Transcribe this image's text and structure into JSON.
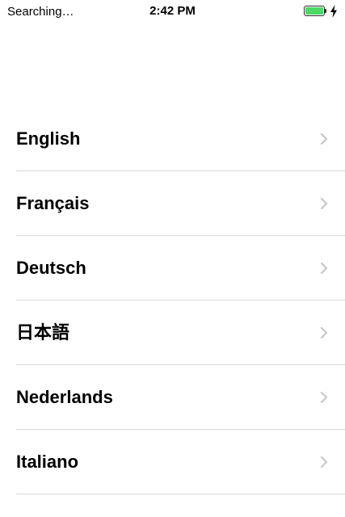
{
  "status_bar": {
    "carrier": "Searching…",
    "time": "2:42 PM",
    "battery_level": 1.0,
    "battery_color": "#4cd964",
    "charging_icon": "lightning-bolt-icon"
  },
  "languages": [
    {
      "label": "English",
      "icon": "chevron-right-icon"
    },
    {
      "label": "Français",
      "icon": "chevron-right-icon"
    },
    {
      "label": "Deutsch",
      "icon": "chevron-right-icon"
    },
    {
      "label": "日本語",
      "icon": "chevron-right-icon"
    },
    {
      "label": "Nederlands",
      "icon": "chevron-right-icon"
    },
    {
      "label": "Italiano",
      "icon": "chevron-right-icon"
    }
  ],
  "colors": {
    "separator": "#d9d9d9",
    "chevron": "#c7c7cc"
  }
}
